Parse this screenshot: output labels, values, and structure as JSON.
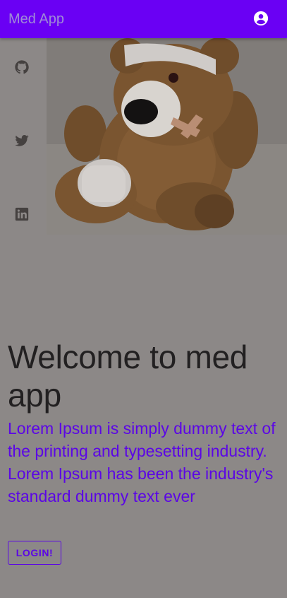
{
  "app": {
    "title": "Med App"
  },
  "header": {
    "account_icon": "account-circle-icon"
  },
  "social": [
    {
      "icon": "github-icon"
    },
    {
      "icon": "twitter-icon"
    },
    {
      "icon": "linkedin-icon"
    }
  ],
  "hero": {
    "image": "teddy-bear-with-bandages"
  },
  "main": {
    "headline": "Welcome to med app",
    "body": "Lorem Ipsum is simply dummy text of the printing and typesetting industry. Lorem Ipsum has been the industry's standard dummy text ever",
    "login_label": "LOGIN!"
  },
  "colors": {
    "appbar": "#6a00f4",
    "accent_text": "#5b06e6",
    "page_background": "#8c8887",
    "headline": "#222021"
  }
}
